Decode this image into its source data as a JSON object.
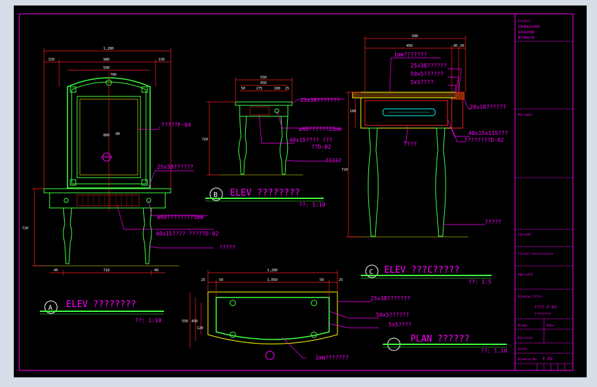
{
  "colors": {
    "frame": "#ff00ff",
    "title_text": "#ff00ff",
    "callout": "#ff00ff",
    "dimension": "#ff2020",
    "outline": "#40ff40",
    "detail": "#ffff00",
    "accent": "#00ffff"
  },
  "views": {
    "a": {
      "marker": "A",
      "title": "ELEV ????????",
      "scale": "??: 1:10"
    },
    "b": {
      "marker": "B",
      "title": "ELEV ????????",
      "scale": "??: 1:10"
    },
    "c": {
      "marker": "C",
      "title": "ELEV ???C?????",
      "scale": "??: 1.5"
    },
    "d": {
      "title": "PLAN   ??????",
      "scale": "??: 1.10"
    }
  },
  "callouts": {
    "a1": "?????F-04",
    "a2": "25x38??????",
    "a3": "ø60????????5mm",
    "a4": "40x15???? ?????D-02",
    "a5": "?????",
    "b1": "25x38???????",
    "b2": "ø60??????25mm",
    "b3": "40x15???? ???",
    "b4": "??D-02",
    "b5": "?????",
    "c1": "1mm???????",
    "c2": "25x38??????",
    "c3": "50x5??????",
    "c4": "5x5????",
    "c5": "20x10??????",
    "c6": "40x15x115???",
    "c7": "????????D-02",
    "c8": "????",
    "c9": "?????",
    "d1": "25x38???????",
    "d2": "50x5??????",
    "d3": "5x5????",
    "d4": "1mm???????"
  },
  "dimensions": {
    "a_w": "1,280",
    "a_l": "150",
    "a_m": "980",
    "a_r": "150",
    "a_in": "930",
    "a_top": "700",
    "a_l2": "40",
    "a_m2": "718",
    "a_r2": "40",
    "a_h": "720",
    "a_c": "860",
    "a_s": "80",
    "b_w": "550",
    "b_m": "450",
    "b_a": "50",
    "b_b": "275",
    "b_c": "100",
    "b_d": "25",
    "b_h": "720",
    "c_w": "500",
    "c_a": "450",
    "c_b": "30",
    "c_c": "20",
    "c_h": "720",
    "c_s": "160",
    "d_w": "1,280",
    "d_a": "25",
    "d_b": "50",
    "d_m": "1,050",
    "d_c": "50",
    "d_d": "25",
    "d_h1": "550",
    "d_h2": "450",
    "d_h3": "120"
  },
  "title_block": {
    "project_label": "Project",
    "project_lines": [
      "学院家具设计图纸",
      "家具设计制图",
      "客厅家具方案"
    ],
    "designer_label": "Designer",
    "checked_label": "Checked",
    "client_label": "Client Construction",
    "approved_label": "Approved",
    "drawing_title_label": "Drawing Title",
    "drawing_title": "????  F-02",
    "drawing_subtitle": "????????",
    "drawn_label": "Drawn",
    "date_label": "Date",
    "revision_label": "Revision",
    "scale_label": "Scale",
    "sheet_no_label": "Drawing No.",
    "sheet_no": "F-02"
  }
}
